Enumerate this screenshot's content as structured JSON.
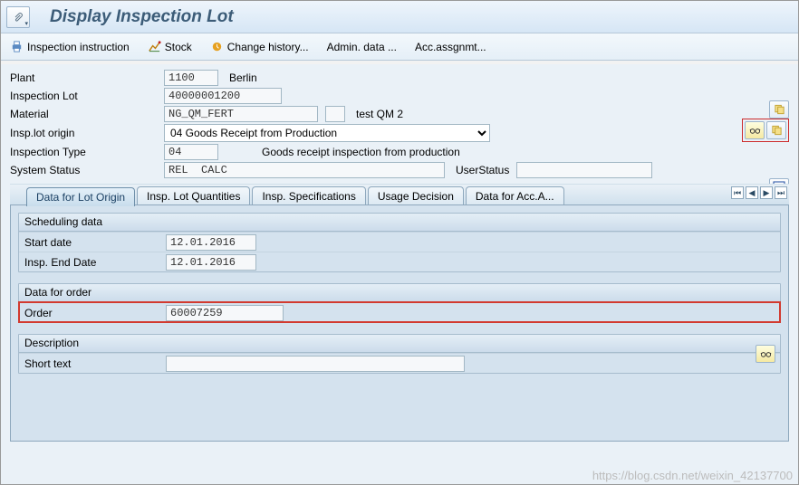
{
  "window": {
    "title": "Display Inspection Lot"
  },
  "toolbar": {
    "inspection_instruction": "Inspection instruction",
    "stock": "Stock",
    "change_history": "Change history...",
    "admin_data": "Admin. data ...",
    "acc_assgnmt": "Acc.assgnmt..."
  },
  "header": {
    "plant_label": "Plant",
    "plant_value": "1100",
    "plant_text": "Berlin",
    "insplot_label": "Inspection Lot",
    "insplot_value": "40000001200",
    "material_label": "Material",
    "material_value": "NG_QM_FERT",
    "material_text": "test QM 2",
    "origin_label": "Insp.lot origin",
    "origin_value": "04 Goods Receipt from Production",
    "insptype_label": "Inspection Type",
    "insptype_value": "04",
    "insptype_text": "Goods receipt inspection from production",
    "system_status_label": "System Status",
    "system_status_value": "REL  CALC",
    "user_status_label": "UserStatus",
    "user_status_value": ""
  },
  "tabs": {
    "t0": "Data for Lot Origin",
    "t1": "Insp. Lot Quantities",
    "t2": "Insp. Specifications",
    "t3": "Usage Decision",
    "t4": "Data for Acc.A..."
  },
  "scheduling": {
    "title": "Scheduling data",
    "start_label": "Start date",
    "start_value": "12.01.2016",
    "end_label": "Insp. End Date",
    "end_value": "12.01.2016"
  },
  "order": {
    "title": "Data for order",
    "order_label": "Order",
    "order_value": "60007259"
  },
  "description": {
    "title": "Description",
    "short_text_label": "Short text",
    "short_text_value": ""
  },
  "watermark": "https://blog.csdn.net/weixin_42137700"
}
